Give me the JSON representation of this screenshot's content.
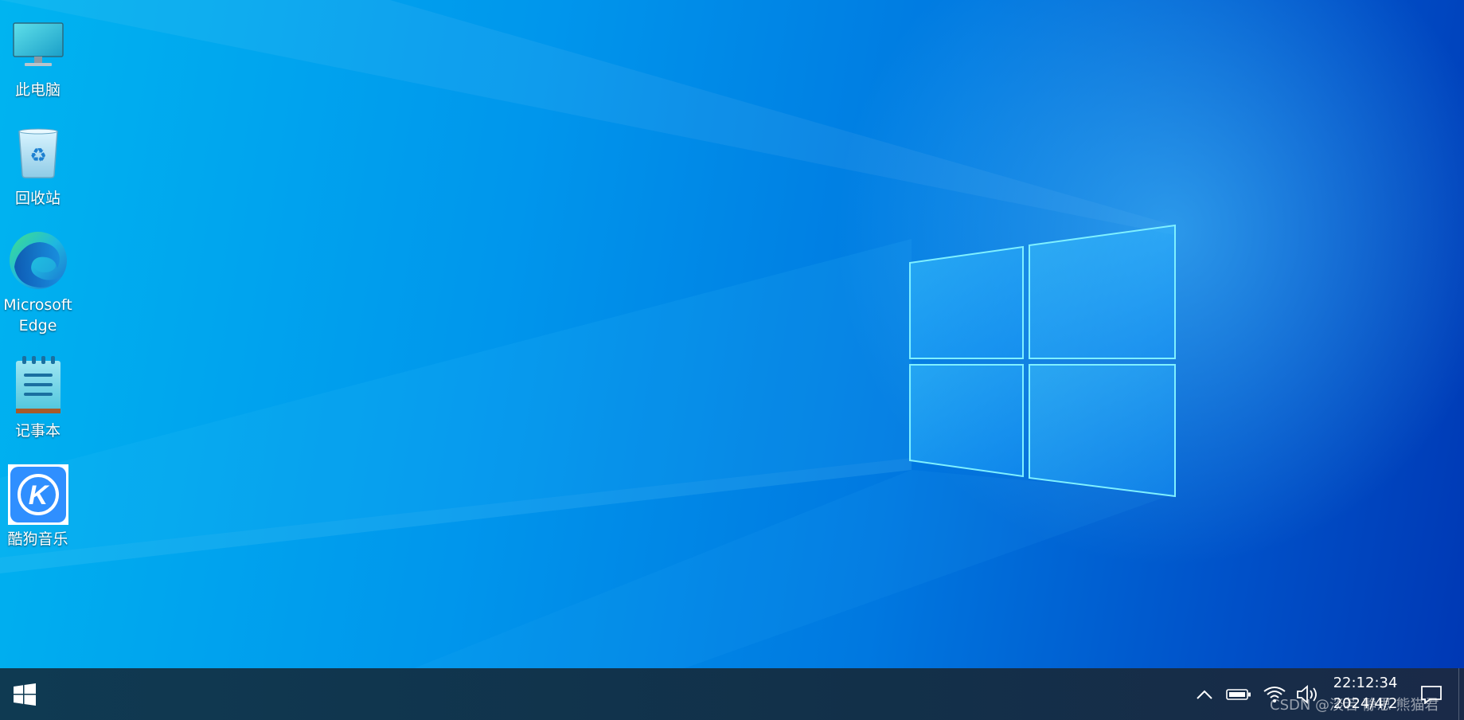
{
  "desktop": {
    "icons": [
      {
        "label": "此电脑",
        "icon": "computer-icon"
      },
      {
        "label": "回收站",
        "icon": "recycle-bin-icon"
      },
      {
        "label": "Microsoft\nEdge",
        "icon": "edge-icon"
      },
      {
        "label": "记事本",
        "icon": "notepad-icon"
      },
      {
        "label": "酷狗音乐",
        "icon": "kugou-music-icon"
      }
    ]
  },
  "taskbar": {
    "start_icon": "windows-logo-icon",
    "tray": {
      "icons": [
        "chevron-up-icon",
        "battery-icon",
        "wifi-icon",
        "volume-icon",
        "notification-icon"
      ],
      "time": "22:12:34",
      "date": "2024/4/2"
    }
  },
  "watermark": "CSDN @淡若 静思 熊猫君",
  "colors": {
    "wallpaper_light": "#00b4f0",
    "wallpaper_dark": "#0038b4",
    "taskbar": "#123049"
  }
}
